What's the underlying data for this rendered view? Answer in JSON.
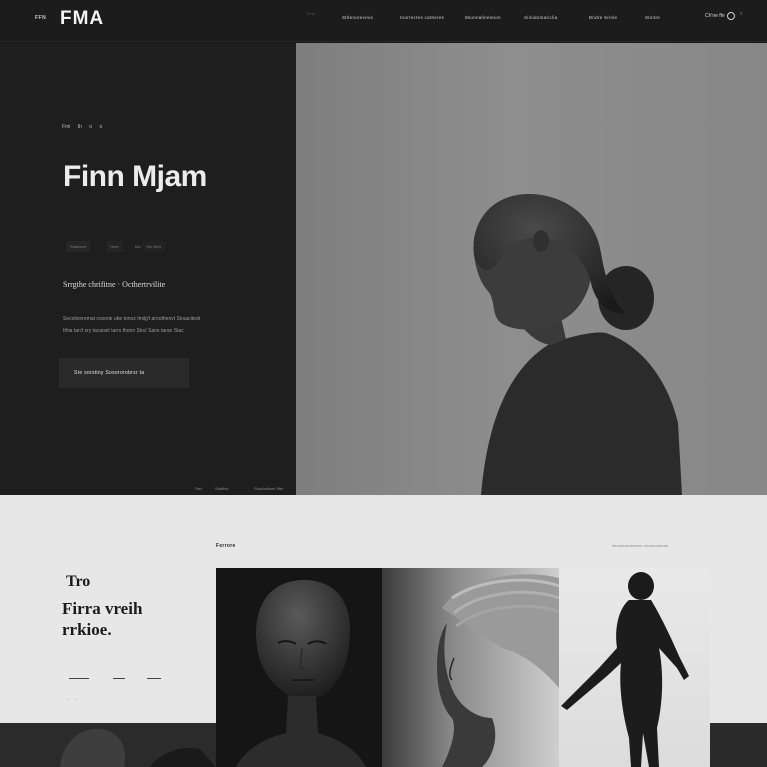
{
  "header": {
    "brand_small": "FFN",
    "brand": "FMA",
    "ghost_link": "Finn",
    "nav": [
      "Sthenorevinis",
      "Inorrectes catheres",
      "Mionnalinestion",
      "Siinidomariclia",
      "Bndre Sirnle",
      "Stintre"
    ],
    "cta_label": "Ch'ne ffe",
    "close_glyph": "x"
  },
  "hero": {
    "tags": "Fmi th o o",
    "title": "Finn Mjam",
    "meta_pills": [
      "Sotanere",
      "Hore",
      "Ma",
      "Ste Merr"
    ],
    "subtitle": "Srrgthe chrifitne · Octhertrvilite",
    "body_lines": [
      "Secotiveremat cosorie ube tonoz Imilg't aroothenvt Siruacitedr",
      "Ithia tan't sry tacaosit tarrs thonn Siru! Sans taran Stac"
    ],
    "cta_label": "Ste sorstiny   Sosororobrsr ta",
    "footer_links": [
      "Siet",
      "Stotfiris",
      "Stowiroltare Stef"
    ]
  },
  "lower": {
    "section_label": "Ferrore",
    "section_link": "Iteoratorechenen rerrroronerore",
    "heading_1": "Tro",
    "heading_2": "Firra vreih rrkioe.",
    "dots": ". ."
  },
  "colors": {
    "dark_bg": "#1e1e1e",
    "photo_gray": "#878787",
    "light_bg": "#e6e7e6",
    "text_light": "#ececec",
    "text_dark": "#1b1b1b"
  }
}
